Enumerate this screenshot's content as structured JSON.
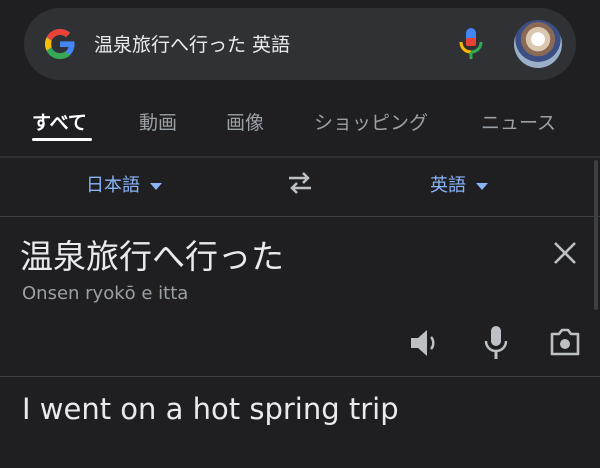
{
  "search": {
    "query": "温泉旅行へ行った 英語"
  },
  "tabs": [
    {
      "label": "すべて"
    },
    {
      "label": "動画"
    },
    {
      "label": "画像"
    },
    {
      "label": "ショッピング"
    },
    {
      "label": "ニュース"
    }
  ],
  "translator": {
    "source_language": "日本語",
    "target_language": "英語",
    "source_text": "温泉旅行へ行った",
    "romanization": "Onsen ryokō e itta",
    "translated_text": "I went on a hot spring trip"
  },
  "colors": {
    "background": "#1f1f21",
    "surface": "#303134",
    "accent": "#8ab4f8",
    "text": "#e8eaed",
    "muted": "#9aa0a6"
  },
  "icons": [
    "google-g-icon",
    "microphone-icon",
    "swap-languages-icon",
    "close-icon",
    "speaker-icon",
    "camera-icon"
  ]
}
